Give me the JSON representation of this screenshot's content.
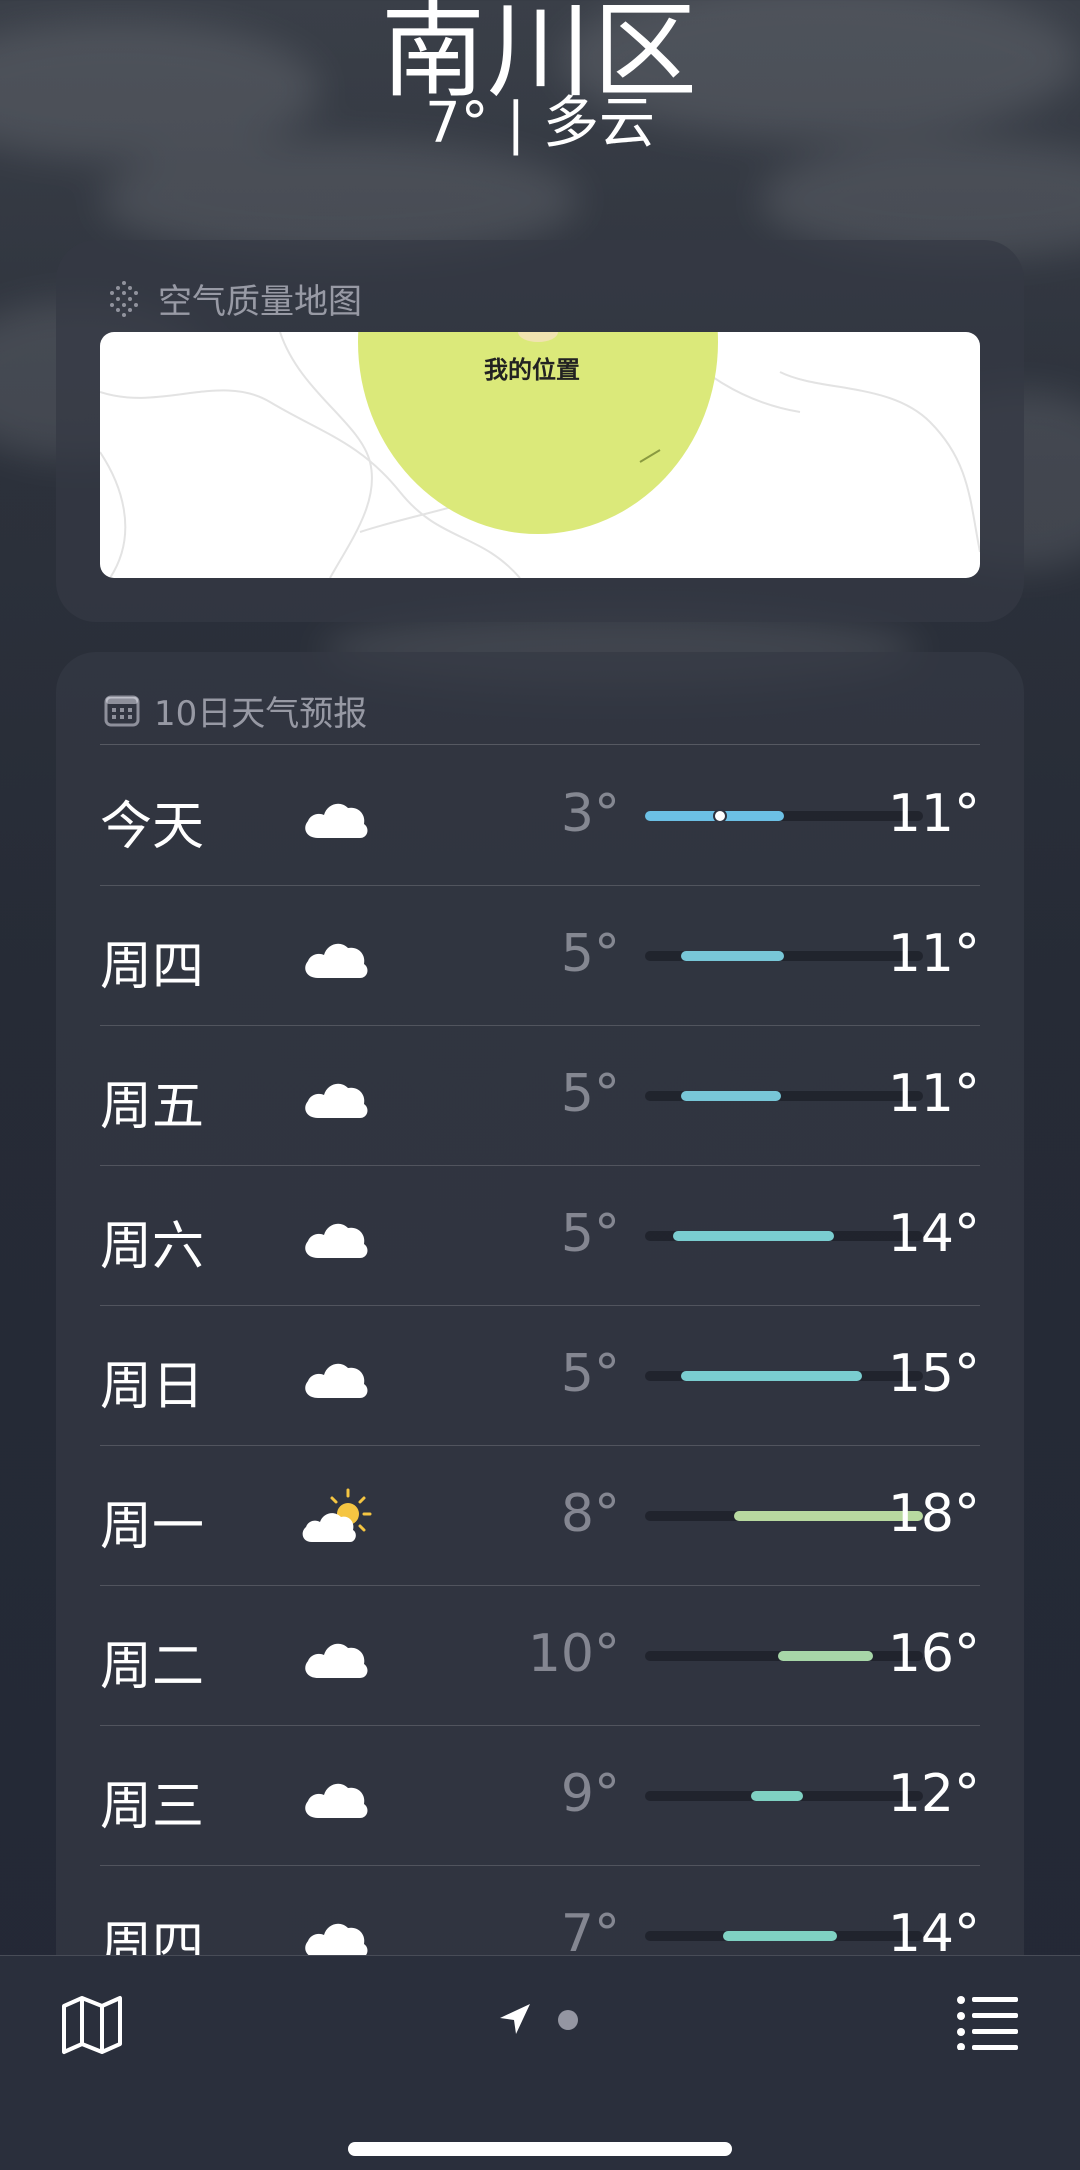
{
  "location": {
    "city": "南川区",
    "subline": "7° | 多云"
  },
  "air_quality": {
    "title": "空气质量地图",
    "map_label": "我的位置",
    "zone_color": "#dbe97a"
  },
  "forecast": {
    "title": "10日天气预报",
    "days": [
      {
        "day": "今天",
        "icon": "cloud-icon",
        "low": "3°",
        "high": "11°",
        "fill_start": 0.0,
        "fill_end": 0.5,
        "current": 0.27,
        "color": "#6cc0e5"
      },
      {
        "day": "周四",
        "icon": "cloud-icon",
        "low": "5°",
        "high": "11°",
        "fill_start": 0.13,
        "fill_end": 0.5,
        "color": "#78c7d8"
      },
      {
        "day": "周五",
        "icon": "cloud-icon",
        "low": "5°",
        "high": "11°",
        "fill_start": 0.13,
        "fill_end": 0.49,
        "color": "#78c7d8"
      },
      {
        "day": "周六",
        "icon": "cloud-icon",
        "low": "5°",
        "high": "14°",
        "fill_start": 0.1,
        "fill_end": 0.68,
        "color": "#7acdd0"
      },
      {
        "day": "周日",
        "icon": "cloud-icon",
        "low": "5°",
        "high": "15°",
        "fill_start": 0.13,
        "fill_end": 0.78,
        "color": "#7acdd0"
      },
      {
        "day": "周一",
        "icon": "sun-cloud-icon",
        "low": "8°",
        "high": "18°",
        "fill_start": 0.32,
        "fill_end": 1.0,
        "color": "#b8d9a0"
      },
      {
        "day": "周二",
        "icon": "cloud-icon",
        "low": "10°",
        "high": "16°",
        "fill_start": 0.48,
        "fill_end": 0.82,
        "color": "#a7d6a8"
      },
      {
        "day": "周三",
        "icon": "cloud-icon",
        "low": "9°",
        "high": "12°",
        "fill_start": 0.38,
        "fill_end": 0.57,
        "color": "#7fd1c3"
      },
      {
        "day": "周四",
        "icon": "cloud-icon",
        "low": "7°",
        "high": "14°",
        "fill_start": 0.28,
        "fill_end": 0.69,
        "color": "#7fd1c3"
      }
    ]
  },
  "toolbar": {
    "map_icon": "map-icon",
    "location_icon": "location-arrow-icon",
    "list_icon": "list-icon"
  }
}
